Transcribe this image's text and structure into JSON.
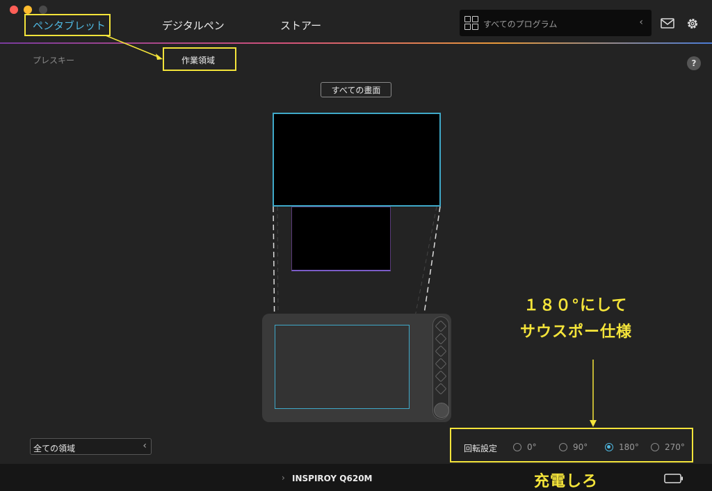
{
  "window": {
    "close_color": "#ff5f57",
    "minimize_color": "#febc2e",
    "zoom_color": "#4a4a4a"
  },
  "nav": {
    "tabs": [
      {
        "label": "ペンタブレット",
        "active": true
      },
      {
        "label": "デジタルペン",
        "active": false
      },
      {
        "label": "ストアー",
        "active": false
      }
    ],
    "program_selector": {
      "label": "すべてのプログラム"
    },
    "mail_icon": "mail-icon",
    "settings_icon": "gear-icon"
  },
  "subnav": {
    "press_keys_label": "プレスキー",
    "work_area_label": "作業領域"
  },
  "help_label": "?",
  "screen_selector": {
    "label": "すべての畫面"
  },
  "area_selector": {
    "value": "全ての領域"
  },
  "rotation": {
    "label": "回転設定",
    "options": [
      "0°",
      "90°",
      "180°",
      "270°"
    ],
    "selected": "180°"
  },
  "footer": {
    "device_name": "INSPIROY Q620M"
  },
  "annotations": {
    "rotation_note_line1": "１８０°にして",
    "rotation_note_line2": "サウスポー仕様",
    "charge_note": "充電しろ",
    "accent_color": "#f4e43a"
  },
  "accent": "#4fb7e0"
}
